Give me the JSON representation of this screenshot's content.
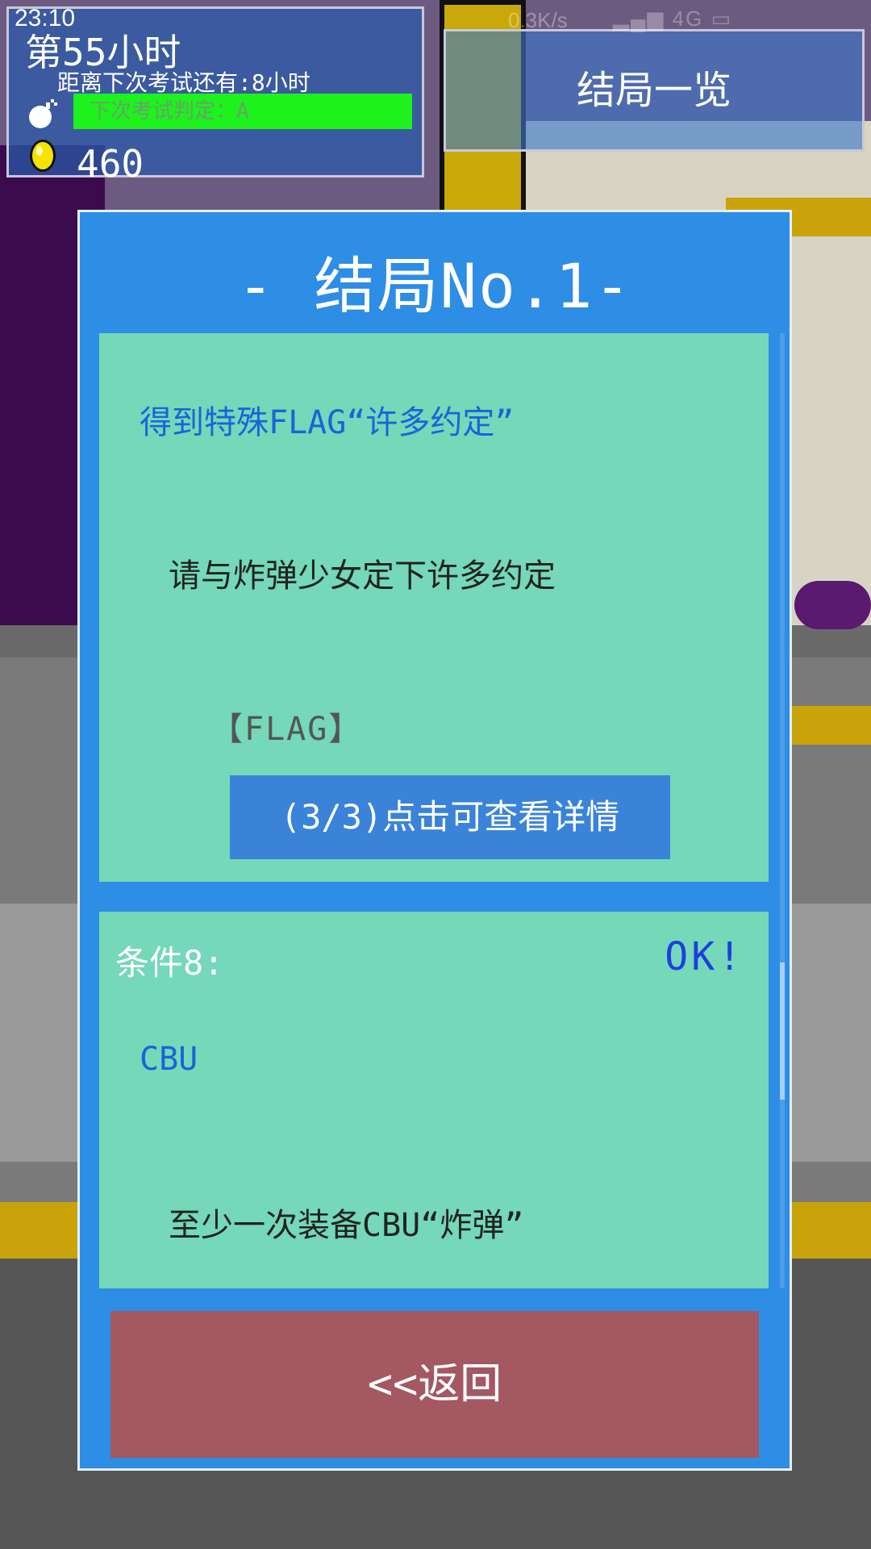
{
  "status_bar": {
    "time": "23:10",
    "network": "0.3K/s",
    "signal": "4G"
  },
  "hud": {
    "hour": "第55小时",
    "remaining": "距离下次考试还有:8小时",
    "grade": "下次考试判定：A",
    "coins": "460",
    "bomb_icon": "bomb-icon",
    "coin_icon": "coin-icon"
  },
  "endings_button": {
    "label": "结局一览"
  },
  "panel": {
    "title": "- 结局No.1-",
    "flag_card": {
      "title": "得到特殊FLAG“许多约定”",
      "description": "请与炸弹少女定下许多约定",
      "tag": "【FLAG】",
      "detail_button": "(3/3)点击可查看详情"
    },
    "condition_card": {
      "label": "条件8:",
      "status": "OK!",
      "name": "CBU",
      "description": "至少一次装备CBU“炸弹”"
    },
    "back_button": "<<返回"
  },
  "colors": {
    "panel": "#2e8de4",
    "card": "#74d8b9",
    "grade_bar": "#1df21d",
    "back_button": "#a35862",
    "detail_button": "#3a83d8"
  }
}
